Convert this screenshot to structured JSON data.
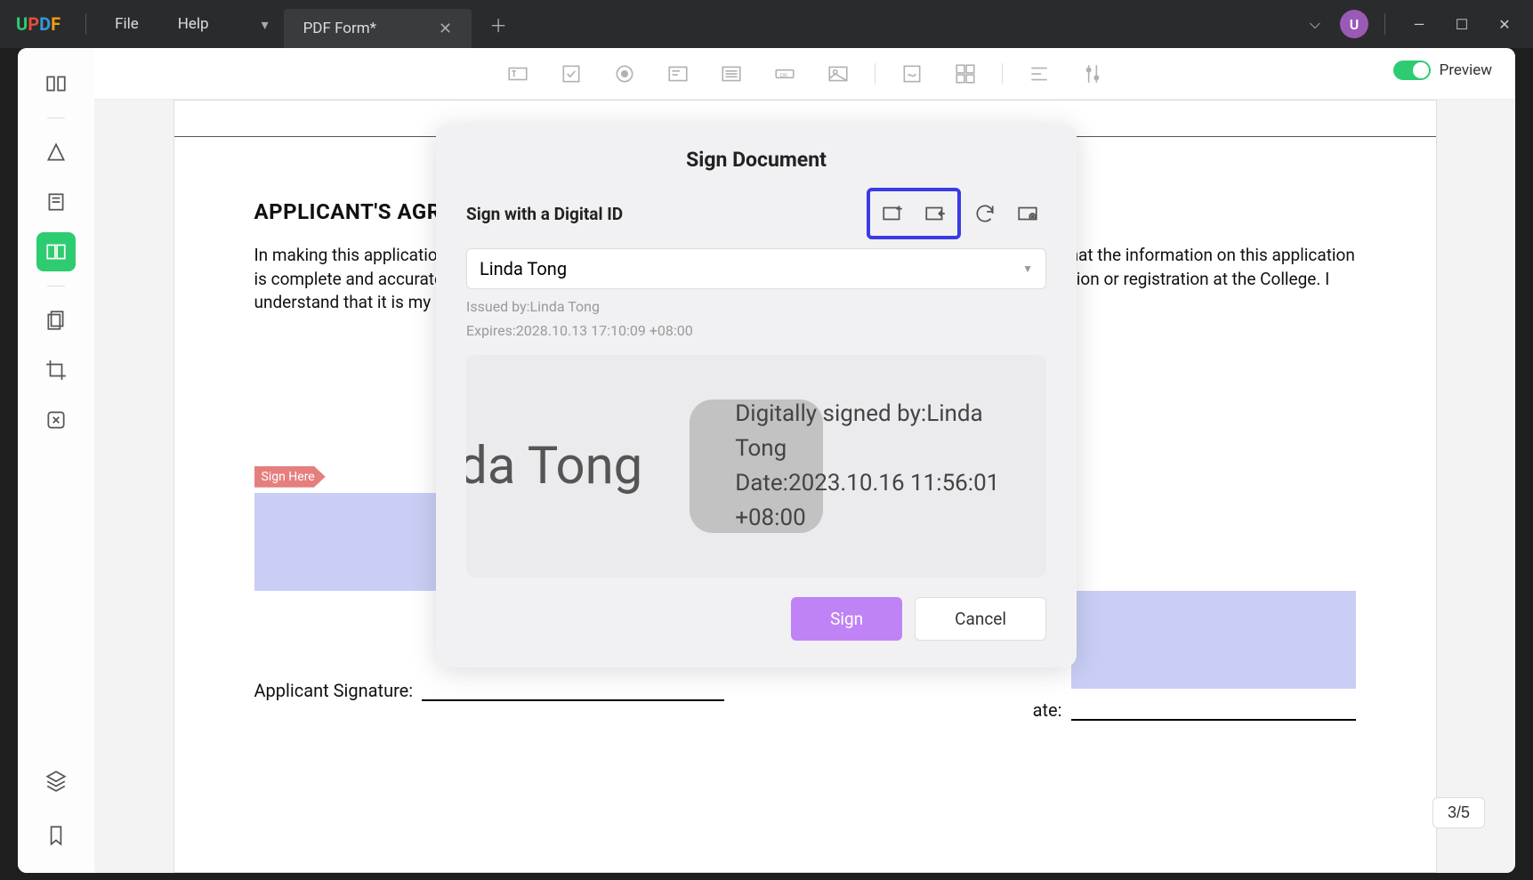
{
  "titlebar": {
    "menu_file": "File",
    "menu_help": "Help",
    "tab_title": "PDF Form*",
    "avatar_letter": "U"
  },
  "toolbar": {
    "preview_label": "Preview"
  },
  "document": {
    "heading": "APPLICANT'S AGREEMEN",
    "paragraph": "In making this application, I accept and agree to abide by the policies and regulations of the College. I affirm that the information on this application is complete and accurate. Failure to provide accurate information may result in the cancellation of my application or registration at the College. I understand that it is my responsibility to notify the Office of Registration of any changes.",
    "sign_here": "Sign Here",
    "sig_label_applicant": "Applicant Signature:",
    "sig_label_date": "ate:"
  },
  "page_indicator": "3/5",
  "modal": {
    "title": "Sign Document",
    "subtitle": "Sign with a Digital ID",
    "selected_id": "Linda Tong",
    "issued_by": "Issued by:Linda Tong",
    "expires": "Expires:2028.10.13 17:10:09 +08:00",
    "preview_name": "Linda Tong",
    "preview_signed_by": "Digitally signed by:Linda Tong",
    "preview_date": "Date:2023.10.16 11:56:01 +08:00",
    "btn_sign": "Sign",
    "btn_cancel": "Cancel"
  }
}
